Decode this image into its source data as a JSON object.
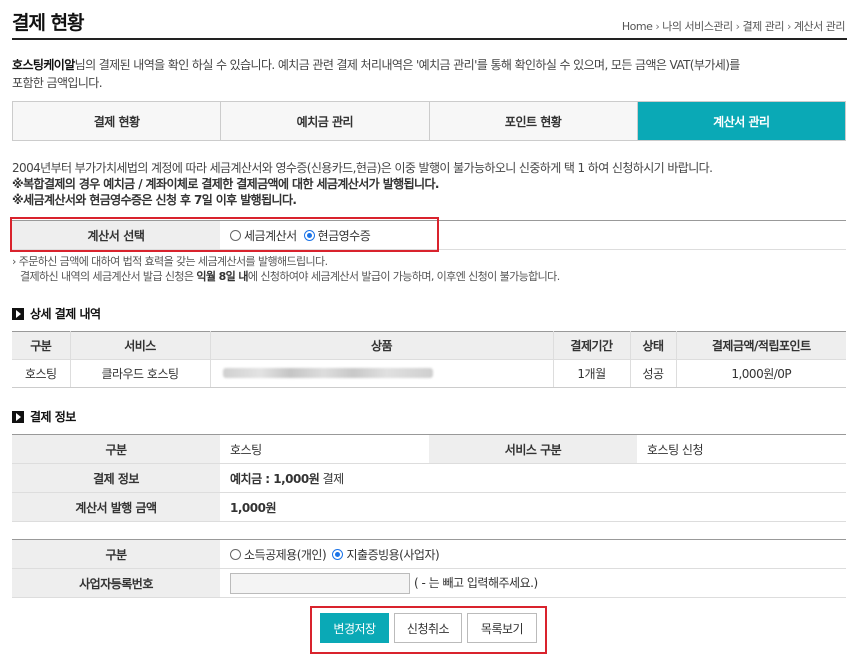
{
  "header": {
    "title": "결제 현황",
    "breadcrumb": [
      "Home",
      "나의 서비스관리",
      "결제 관리",
      "계산서 관리"
    ]
  },
  "intro": {
    "brand": "호스팅케이알",
    "text1": "님의 결제된 내역을 확인 하실 수 있습니다. 예치금 관련 결제 처리내역은 '예치금 관리'를 통해 확인하실 수 있으며, 모든 금액은 VAT(부가세)를",
    "text2": "포함한 금액입니다."
  },
  "tabs": [
    {
      "label": "결제 현황"
    },
    {
      "label": "예치금 관리"
    },
    {
      "label": "포인트 현황"
    },
    {
      "label": "계산서 관리"
    }
  ],
  "notice": {
    "line1": "2004년부터 부가가치세법의 계정에 따라 세금계산서와 영수증(신용카드,현금)은 이중 발행이 불가능하오니 신중하게 택 1 하여 신청하시기 바랍니다.",
    "line2": "※복합결제의 경우 예치금 / 계좌이체로 결제한 결제금액에 대한 세금계산서가 발행됩니다.",
    "line3": "※세금계산서와 현금영수증은 신청 후 7일 이후 발행됩니다."
  },
  "invoice_select": {
    "label": "계산서 선택",
    "option1": "세금계산서",
    "option2": "현금영수증",
    "selected": "현금영수증"
  },
  "small_notes": {
    "line1": "주문하신 금액에 대하여 법적 효력을 갖는 세금계산서를 발행해드립니다.",
    "line2_a": "결제하신 내역의 세금계산서 발급 신청은 ",
    "line2_b": "익월 8일 내",
    "line2_c": "에 신청하여야 세금계산서 발급이 가능하며, 이후엔 신청이 불가능합니다."
  },
  "detail": {
    "title": "상세 결제 내역",
    "headers": [
      "구분",
      "서비스",
      "상품",
      "결제기간",
      "상태",
      "결제금액/적립포인트"
    ],
    "row": {
      "type": "호스팅",
      "service": "클라우드 호스팅",
      "period": "1개월",
      "status": "성공",
      "amount": "1,000원/0P"
    }
  },
  "payinfo": {
    "title": "결제 정보",
    "type_label": "구분",
    "type_value": "호스팅",
    "service_label": "서비스 구분",
    "service_value": "호스팅 신청",
    "pay_label": "결제 정보",
    "pay_value": "예치금 : 1,000원",
    "pay_suffix": "결제",
    "amount_label": "계산서 발행 금액",
    "amount_value": "1,000원"
  },
  "receipt": {
    "type_label": "구분",
    "option1": "소득공제용(개인)",
    "option2": "지출증빙용(사업자)",
    "selected": "지출증빙용(사업자)",
    "regno_label": "사업자등록번호",
    "regno_value": "",
    "regno_hint": "( - 는 빼고 입력해주세요.)"
  },
  "buttons": {
    "save": "변경저장",
    "cancel": "신청취소",
    "list": "목록보기"
  },
  "colors": {
    "accent": "#0aa9b6",
    "highlight": "#d9232d"
  }
}
